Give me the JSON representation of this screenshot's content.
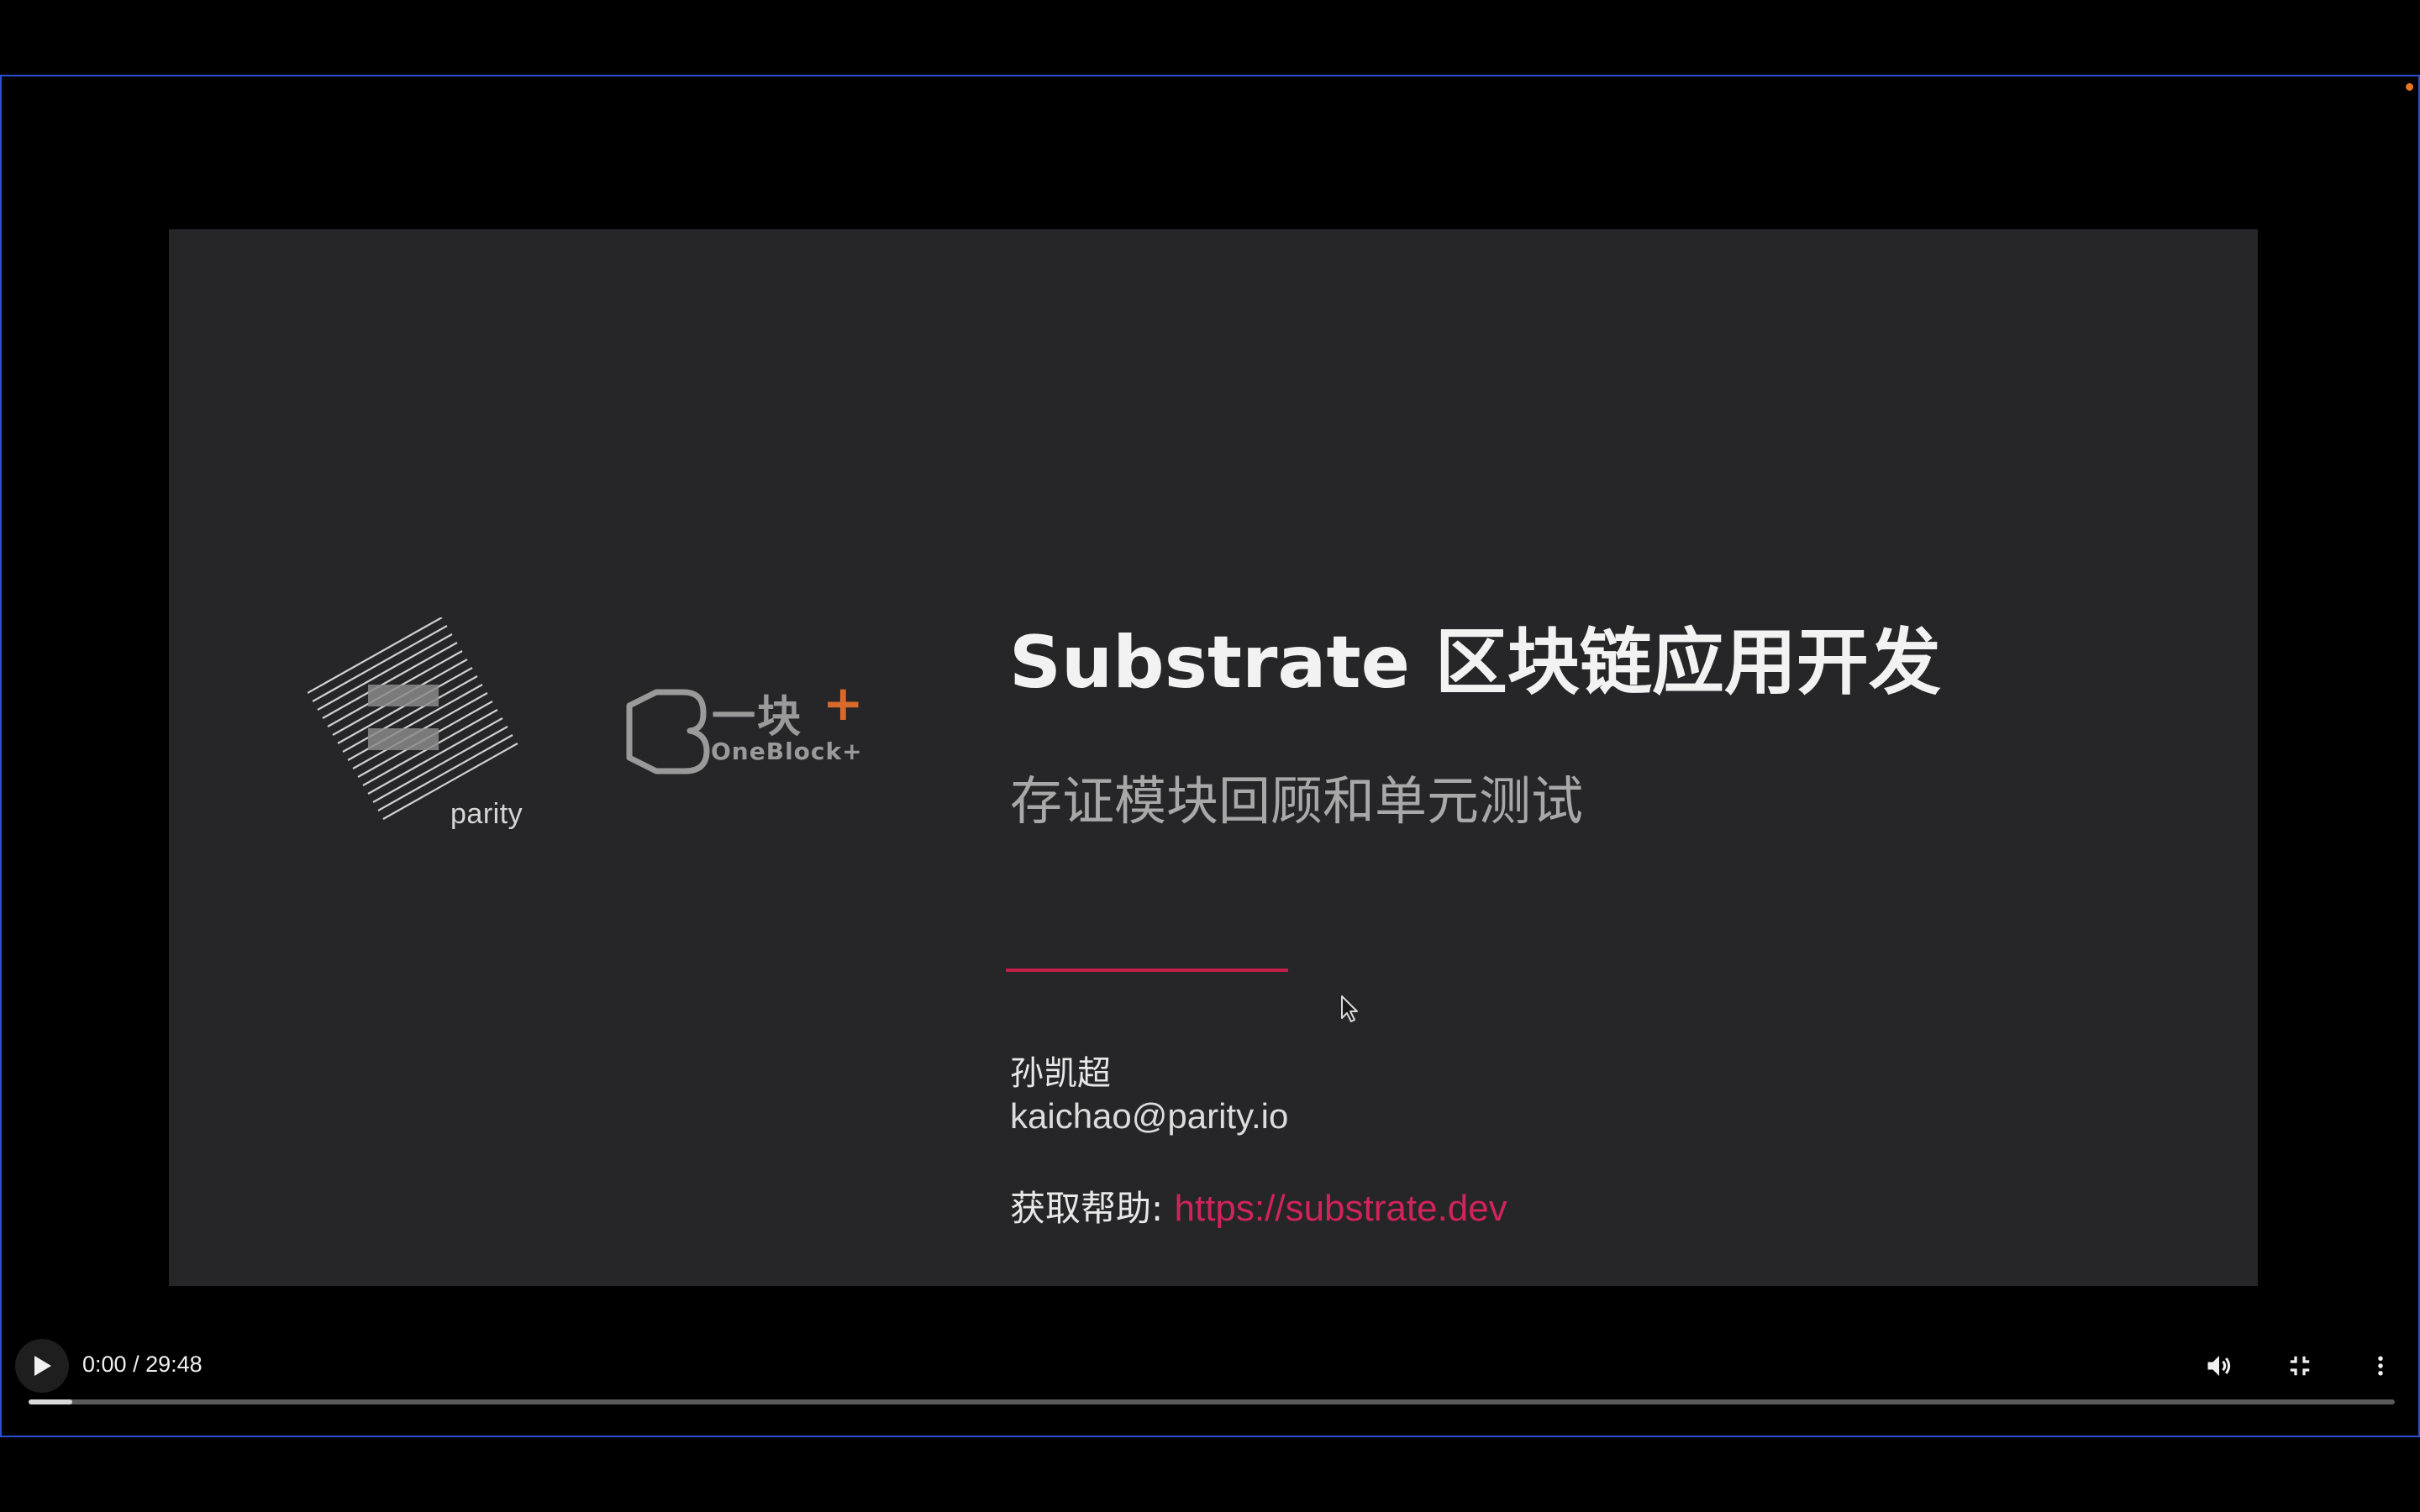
{
  "slide": {
    "title": "Substrate 区块链应用开发",
    "subtitle": "存证模块回顾和单元测试",
    "author_name": "孙凯超",
    "author_email": "kaichao@parity.io",
    "help_label": "获取帮助: ",
    "help_link": "https://substrate.dev",
    "logos": {
      "parity_text": "parity",
      "oneblock_cn": "一块",
      "oneblock_plus": "+",
      "oneblock_en": "OneBlock+"
    },
    "colors": {
      "background": "#262628",
      "accent": "#c41e4a",
      "oneblock_orange": "#d8692a"
    }
  },
  "player": {
    "current_time": "0:00",
    "separator": " / ",
    "duration": "29:48",
    "progress": 0.018,
    "icons": {
      "play": "play-icon",
      "volume": "volume-icon",
      "exit_fullscreen": "exit-fullscreen-icon",
      "more": "more-vert-icon"
    }
  }
}
